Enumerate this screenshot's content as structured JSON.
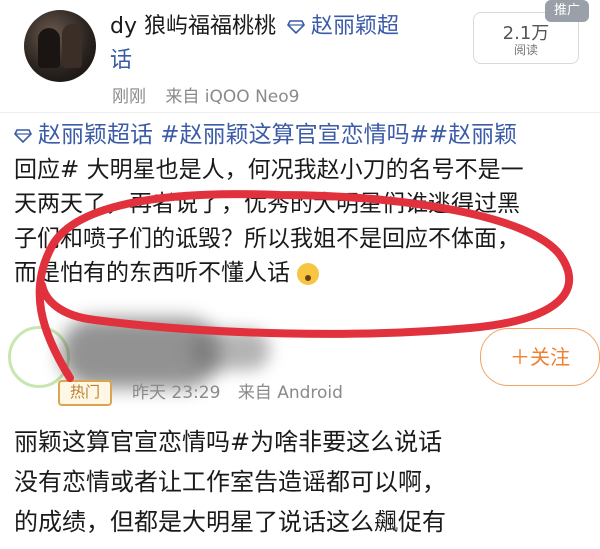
{
  "post": {
    "username": "dy 狼屿福福桃桃",
    "super_topic_label": "赵丽颖超",
    "super_topic_label_2": "话",
    "time": "刚刚",
    "source": "来自 iQOO Neo9",
    "reads_count": "2.1万",
    "reads_label": "阅读",
    "ad_badge": "推广",
    "body_lines": [
      "赵丽颖超话 #赵丽颖这算官宣恋情吗##赵丽颖",
      "回应# 大明星也是人，何况我赵小刀的名号不是一",
      "天两天了，再者说了，优秀的大明星们谁逃得过黑",
      "子们和喷子们的诋毁？所以我姐不是回应不体面，",
      "而是怕有的东西听不懂人话"
    ]
  },
  "second_post": {
    "hot_label": "热门",
    "time": "昨天 23:29",
    "source": "来自 Android",
    "follow_label": "＋关注",
    "body_lines": [
      "丽颖这算官宣恋情吗#为啥非要这么说话",
      "没有恋情或者让工作室告造谣都可以啊，",
      "的成绩，但都是大明星了说话这么飆促有"
    ]
  },
  "colors": {
    "link": "#3b5ba8",
    "annotation": "#e0313d",
    "follow": "#f07f2e"
  }
}
